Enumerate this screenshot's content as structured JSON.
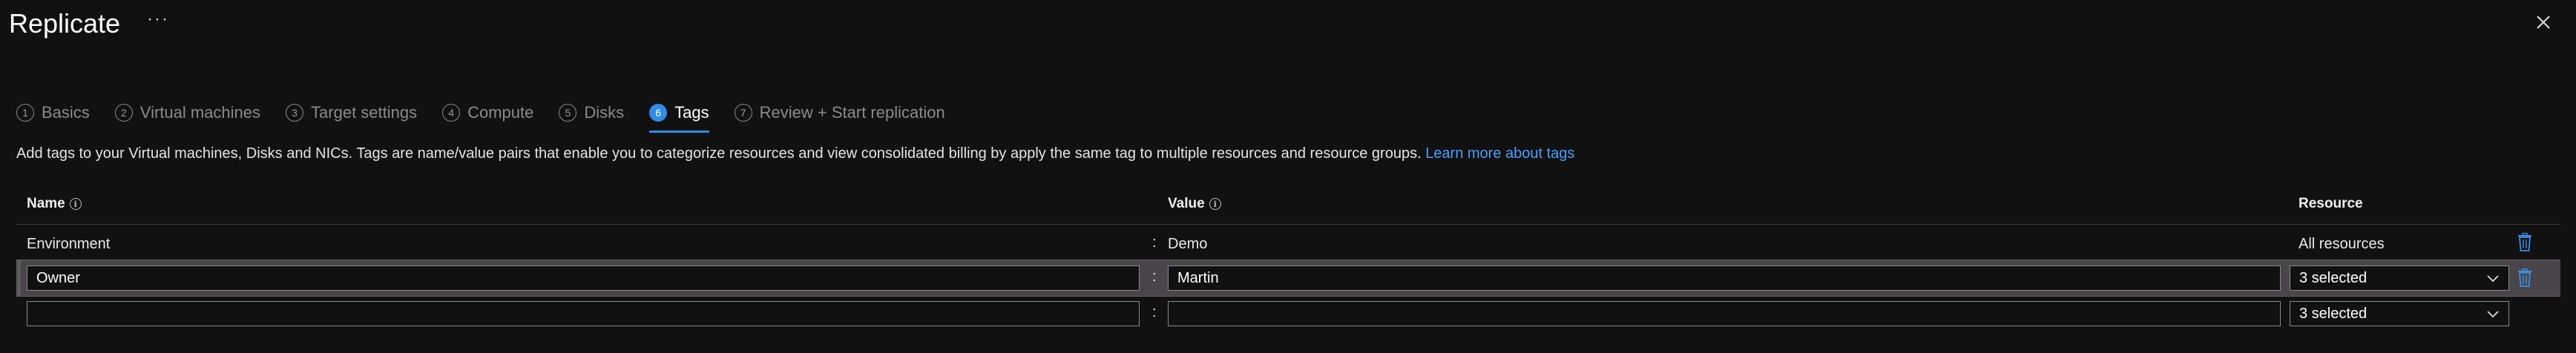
{
  "header": {
    "title": "Replicate",
    "more_label": "···"
  },
  "steps": [
    {
      "num": "1",
      "label": "Basics"
    },
    {
      "num": "2",
      "label": "Virtual machines"
    },
    {
      "num": "3",
      "label": "Target settings"
    },
    {
      "num": "4",
      "label": "Compute"
    },
    {
      "num": "5",
      "label": "Disks"
    },
    {
      "num": "6",
      "label": "Tags"
    },
    {
      "num": "7",
      "label": "Review + Start replication"
    }
  ],
  "active_step": "Tags",
  "description": {
    "text": "Add tags to your Virtual machines, Disks and NICs. Tags are name/value pairs that enable you to categorize resources and view consolidated billing by apply the same tag to multiple resources and resource groups.",
    "link": "Learn more about tags"
  },
  "table": {
    "headers": {
      "name": "Name",
      "value": "Value",
      "resource": "Resource"
    },
    "separator": ":",
    "rows": [
      {
        "name": "Environment",
        "value": "Demo",
        "resource": "All resources"
      },
      {
        "name": "Owner",
        "value": "Martin",
        "resource": "3 selected"
      },
      {
        "name": "",
        "value": "",
        "resource": "3 selected"
      }
    ]
  },
  "colors": {
    "accent": "#2f8ce8",
    "link": "#4a9eff",
    "background": "#111111",
    "selected_row": "#4a454a"
  }
}
